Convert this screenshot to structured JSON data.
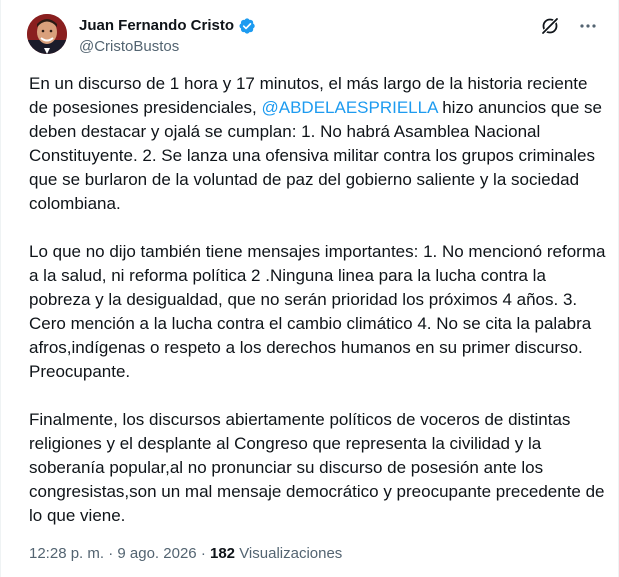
{
  "author": {
    "display_name": "Juan Fernando Cristo",
    "handle": "@CristoBustos"
  },
  "tweet": {
    "paragraphs": [
      {
        "before": "En un discurso de 1 hora y 17 minutos, el más largo de la historia reciente de posesiones presidenciales, ",
        "mention": "@ABDELAESPRIELLA",
        "after": " hizo anuncios que se deben destacar y ojalá se cumplan: 1. No habrá Asamblea Nacional Constituyente. 2. Se lanza una ofensiva militar contra los grupos criminales que se burlaron de la voluntad de paz del gobierno saliente y la sociedad colombiana."
      },
      {
        "text": "Lo que no dijo también tiene mensajes importantes: 1. No mencionó reforma a la salud, ni reforma política 2 .Ninguna linea para la lucha contra la pobreza y la desigualdad, que no serán prioridad los próximos 4 años. 3. Cero mención a la lucha contra el cambio climático 4. No se cita la palabra afros,indígenas o respeto a los derechos humanos en su primer discurso. Preocupante."
      },
      {
        "text": "Finalmente, los discursos abiertamente políticos de voceros de distintas religiones y el desplante al Congreso que representa la civilidad y la soberanía popular,al no pronunciar  su discurso de posesión ante los congresistas,son un mal mensaje democrático y preocupante precedente de lo que viene."
      }
    ]
  },
  "meta": {
    "time": "12:28 p. m.",
    "separator": "·",
    "date": "9 ago. 2026",
    "views_count": "182",
    "views_label": "Visualizaciones"
  },
  "colors": {
    "link": "#1d9bf0",
    "text": "#0f1419",
    "secondary": "#536471",
    "verified": "#1d9bf0"
  },
  "icons": {
    "verified": "verified-badge-icon",
    "grok": "grok-icon",
    "more": "more-options-icon"
  }
}
